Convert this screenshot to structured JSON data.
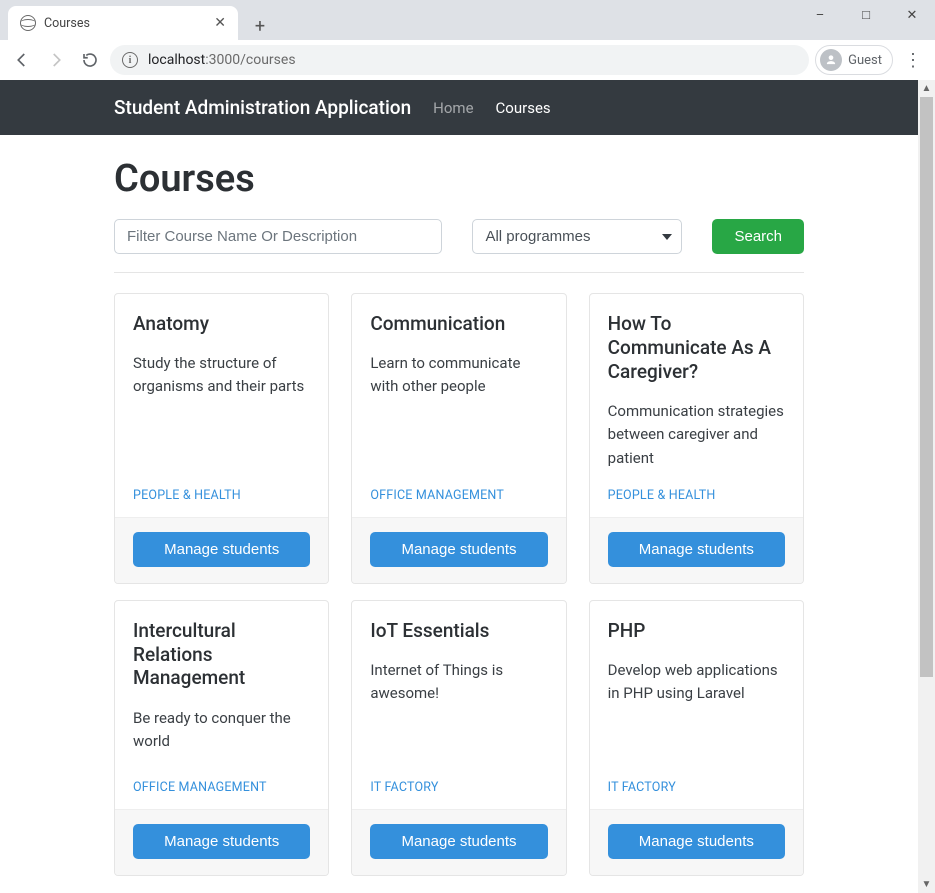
{
  "browser": {
    "tab_title": "Courses",
    "url_host": "localhost",
    "url_port": ":3000",
    "url_path": "/courses",
    "profile_label": "Guest"
  },
  "navbar": {
    "brand": "Student Administration Application",
    "link_home": "Home",
    "link_courses": "Courses"
  },
  "page": {
    "title": "Courses",
    "filter_placeholder": "Filter Course Name Or Description",
    "programme_selected": "All programmes",
    "search_label": "Search",
    "manage_label": "Manage students"
  },
  "courses": [
    {
      "title": "Anatomy",
      "desc": "Study the structure of organisms and their parts",
      "tag": "PEOPLE & HEALTH"
    },
    {
      "title": "Communication",
      "desc": "Learn to communicate with other people",
      "tag": "OFFICE MANAGEMENT"
    },
    {
      "title": "How To Communicate As A Caregiver?",
      "desc": "Communication strategies between caregiver and patient",
      "tag": "PEOPLE & HEALTH"
    },
    {
      "title": "Intercultural Relations Management",
      "desc": "Be ready to conquer the world",
      "tag": "OFFICE MANAGEMENT"
    },
    {
      "title": "IoT Essentials",
      "desc": "Internet of Things is awesome!",
      "tag": "IT FACTORY"
    },
    {
      "title": "PHP",
      "desc": "Develop web applications in PHP using Laravel",
      "tag": "IT FACTORY"
    }
  ]
}
